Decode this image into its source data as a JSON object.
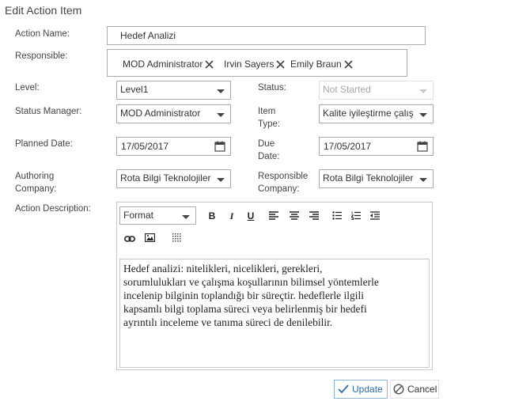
{
  "dialog": {
    "title": "Edit Action Item"
  },
  "fields": {
    "action_name": {
      "label": "Action Name:",
      "value": "Hedef Analizi"
    },
    "responsible": {
      "label": "Responsible:",
      "people": [
        "MOD Administrator",
        "Irvin Sayers",
        "Emily Braun"
      ]
    },
    "level": {
      "label": "Level:",
      "value": "Level1"
    },
    "status": {
      "label": "Status:",
      "value": "Not Started",
      "disabled": true
    },
    "status_manager": {
      "label": "Status Manager:",
      "value": "MOD Administrator"
    },
    "item_type": {
      "label_line1": "Item",
      "label_line2": "Type:",
      "value": "Kalite iyileştirme çalış…"
    },
    "planned_date": {
      "label": "Planned Date:",
      "value": "17/05/2017"
    },
    "due_date": {
      "label_line1": "Due",
      "label_line2": "Date:",
      "value": "17/05/2017"
    },
    "authoring_company": {
      "label_line1": "Authoring",
      "label_line2": "Company:",
      "value": "Rota Bilgi Teknolojileri"
    },
    "responsible_company": {
      "label_line1": "Responsible",
      "label_line2": "Company:",
      "value": "Rota Bilgi Teknolojileri"
    },
    "action_description": {
      "label": "Action Description:",
      "format_value": "Format",
      "toolbar_glyphs": {
        "bold": "B",
        "italic": "I",
        "underline": "U"
      },
      "lines": [
        "Hedef analizi: nitelikleri, nicelikleri, gerekleri,",
        "sorumlulukları ve çalışma koşullarının bilimsel yöntemlerle",
        "incelenip bilginin toplandığı bir süreçtir. hedeflerle ilgili",
        "kapsamlı bilgi toplama süreci veya belirlenmiş bir hedefi",
        "ayrıntılı inceleme ve tanıma süreci de denilebilir."
      ]
    }
  },
  "buttons": {
    "update": "Update",
    "cancel": "Cancel"
  },
  "icons": [
    "close-icon",
    "calendar-icon",
    "align-left-icon",
    "align-center-icon",
    "align-right-icon",
    "bullet-list-icon",
    "numbered-list-icon",
    "outdent-icon",
    "link-icon",
    "image-icon",
    "table-icon",
    "checkmark-icon",
    "cancel-icon"
  ],
  "colors": {
    "accent": "#2a6cb0",
    "border": "#ababab"
  }
}
